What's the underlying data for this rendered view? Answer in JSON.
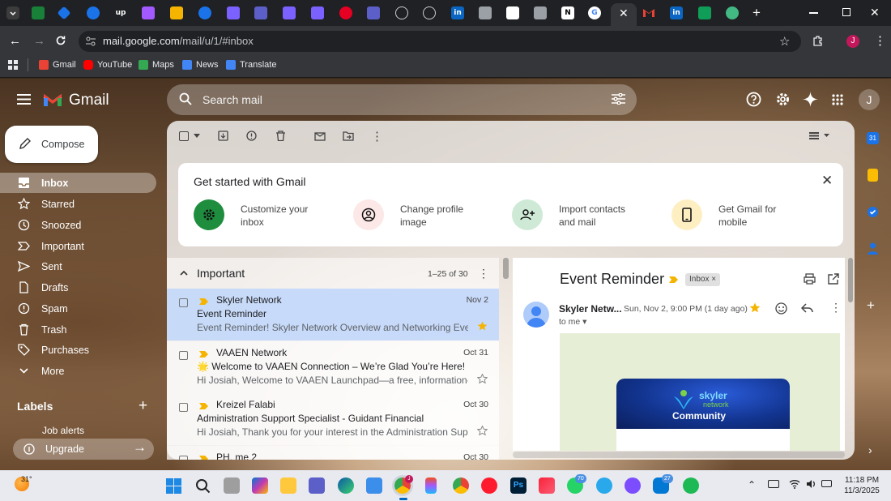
{
  "browser": {
    "url_host": "mail.google.com",
    "url_path": "/mail/u/1/#inbox",
    "profile_initial": "J",
    "bookmarks": [
      {
        "label": "Gmail",
        "color": "#ea4335"
      },
      {
        "label": "YouTube",
        "color": "#ff0000"
      },
      {
        "label": "Maps",
        "color": "#34a853"
      },
      {
        "label": "News",
        "color": "#4285f4"
      },
      {
        "label": "Translate",
        "color": "#4285f4"
      }
    ]
  },
  "gmail": {
    "logo_text": "Gmail",
    "search_placeholder": "Search mail",
    "account_initial": "J",
    "compose_label": "Compose",
    "nav": [
      {
        "label": "Inbox",
        "icon": "inbox-icon"
      },
      {
        "label": "Starred",
        "icon": "star-icon"
      },
      {
        "label": "Snoozed",
        "icon": "clock-icon"
      },
      {
        "label": "Important",
        "icon": "important-icon"
      },
      {
        "label": "Sent",
        "icon": "send-icon"
      },
      {
        "label": "Drafts",
        "icon": "draft-icon"
      },
      {
        "label": "Spam",
        "icon": "spam-icon"
      },
      {
        "label": "Trash",
        "icon": "trash-icon"
      },
      {
        "label": "Purchases",
        "icon": "tag-icon"
      },
      {
        "label": "More",
        "icon": "chevron-down-icon"
      }
    ],
    "labels_heading": "Labels",
    "label_partial": "Job alerts",
    "upgrade_label": "Upgrade"
  },
  "getstarted": {
    "title": "Get started with Gmail",
    "items": [
      {
        "line1": "Customize your",
        "line2": "inbox",
        "color": "#1e8e3e"
      },
      {
        "line1": "Change profile",
        "line2": "image",
        "color": "#fce8e6"
      },
      {
        "line1": "Import contacts",
        "line2": "and mail",
        "color": "#ceead6"
      },
      {
        "line1": "Get Gmail for",
        "line2": "mobile",
        "color": "#feefc3"
      }
    ]
  },
  "list": {
    "section": "Important",
    "range": "1–25 of 30",
    "rows": [
      {
        "sender": "Skyler Network",
        "date": "Nov 2",
        "subject": "Event Reminder",
        "snippet": "Event Reminder! Skyler Network Overview and Networking Event...",
        "starred": true
      },
      {
        "sender": "VAAEN Network",
        "date": "Oct 31",
        "subject": "🌟 Welcome to VAAEN Connection – We’re Glad You’re Here!",
        "snippet": "Hi Josiah, Welcome to VAAEN Launchpad—a free, information-o...",
        "starred": false
      },
      {
        "sender": "Kreizel Falabi",
        "date": "Oct 30",
        "subject": "Administration Support Specialist - Guidant Financial",
        "snippet": "Hi Josiah, Thank you for your interest in the Administration Supp...",
        "starred": false
      },
      {
        "sender": "PH, me 2",
        "date": "Oct 30",
        "subject": "",
        "snippet": "",
        "starred": false
      }
    ]
  },
  "reader": {
    "subject": "Event Reminder",
    "tag": "Inbox",
    "sender": "Skyler Netw...",
    "datetime": "Sun, Nov 2, 9:00 PM (1 day ago)",
    "to": "to me",
    "banner_line1": "skyler",
    "banner_line2": "network",
    "banner_line3": "Community"
  },
  "taskbar": {
    "weather": "31°",
    "time": "11:18 PM",
    "date": "11/3/2025",
    "badge_whatsapp": "70",
    "badge_telegram": "27"
  }
}
